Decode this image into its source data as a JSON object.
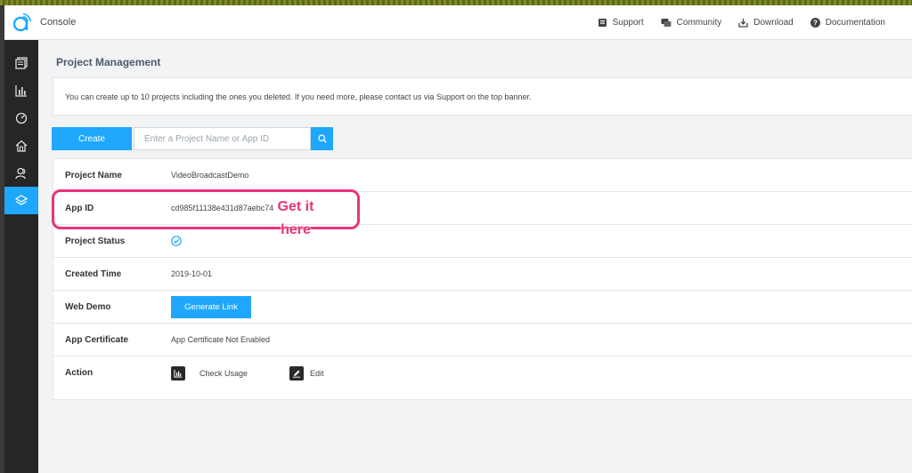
{
  "header": {
    "title": "Console",
    "nav": [
      {
        "label": "Support",
        "icon": "support-icon"
      },
      {
        "label": "Community",
        "icon": "community-icon"
      },
      {
        "label": "Download",
        "icon": "download-icon"
      },
      {
        "label": "Documentation",
        "icon": "help-icon"
      }
    ]
  },
  "sidebar": {
    "items": [
      {
        "icon": "projects-list-icon",
        "active": false
      },
      {
        "icon": "analytics-icon",
        "active": false
      },
      {
        "icon": "dashboard-gauge-icon",
        "active": false
      },
      {
        "icon": "home-icon",
        "active": false
      },
      {
        "icon": "users-icon",
        "active": false
      },
      {
        "icon": "layers-icon",
        "active": true
      }
    ]
  },
  "page": {
    "title": "Project Management",
    "notice": "You can create up to 10 projects including the ones you deleted. If you need more, please contact us via Support on the top banner."
  },
  "toolbar": {
    "create_label": "Create",
    "search_placeholder": "Enter a Project Name or App ID",
    "search_value": ""
  },
  "details": {
    "project_name": {
      "label": "Project Name",
      "value": "VideoBroadcastDemo"
    },
    "app_id": {
      "label": "App ID",
      "value": "cd985f11138e431d87aebc74"
    },
    "project_status": {
      "label": "Project Status",
      "checked": true
    },
    "created_time": {
      "label": "Created Time",
      "value": "2019-10-01"
    },
    "web_demo": {
      "label": "Web Demo",
      "button": "Generate Link"
    },
    "app_certificate": {
      "label": "App Certificate",
      "value": "App Certificate Not Enabled"
    },
    "action": {
      "label": "Action",
      "check_usage": "Check Usage",
      "edit": "Edit"
    }
  },
  "annotation": {
    "text_line1": "Get it",
    "text_line2": "here",
    "color": "#e9347a"
  },
  "colors": {
    "accent": "#1ea7fd",
    "sidebar_bg": "#262626"
  }
}
